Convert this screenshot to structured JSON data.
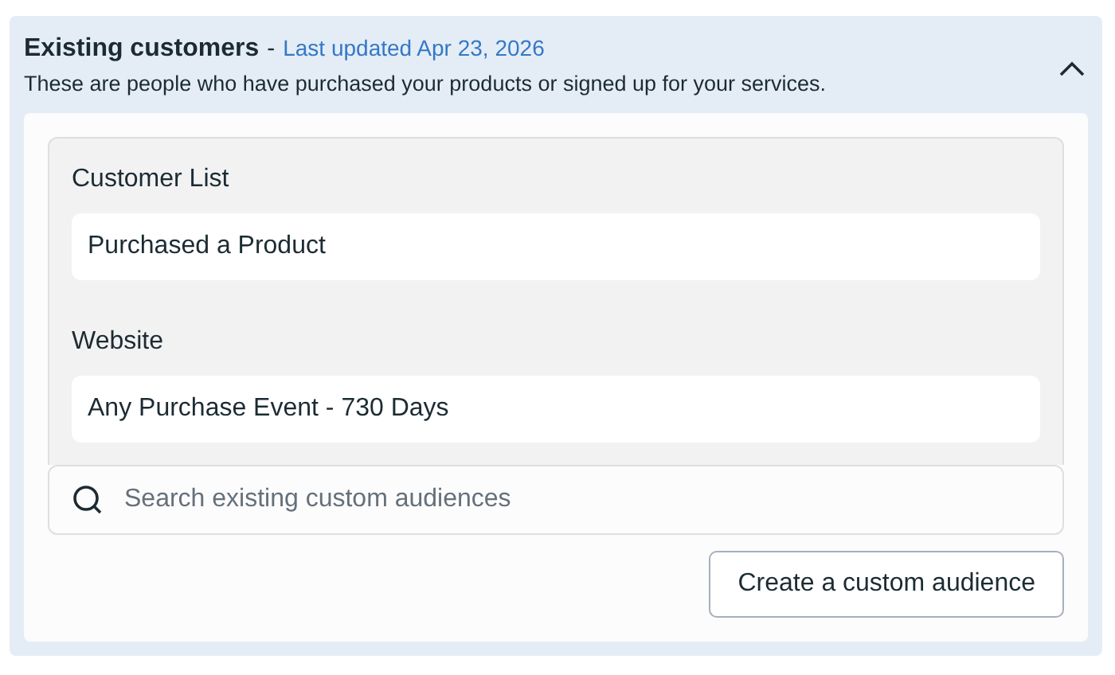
{
  "section": {
    "title": "Existing customers",
    "separator": "-",
    "updated": "Last updated Apr 23, 2026",
    "description": "These are people who have purchased your products or signed up for your services.",
    "expanded": true
  },
  "groups": [
    {
      "label": "Customer List",
      "items": [
        "Purchased a Product"
      ]
    },
    {
      "label": "Website",
      "items": [
        "Any Purchase Event - 730 Days"
      ]
    }
  ],
  "search": {
    "placeholder": "Search existing custom audiences"
  },
  "button": "Create a custom audience"
}
